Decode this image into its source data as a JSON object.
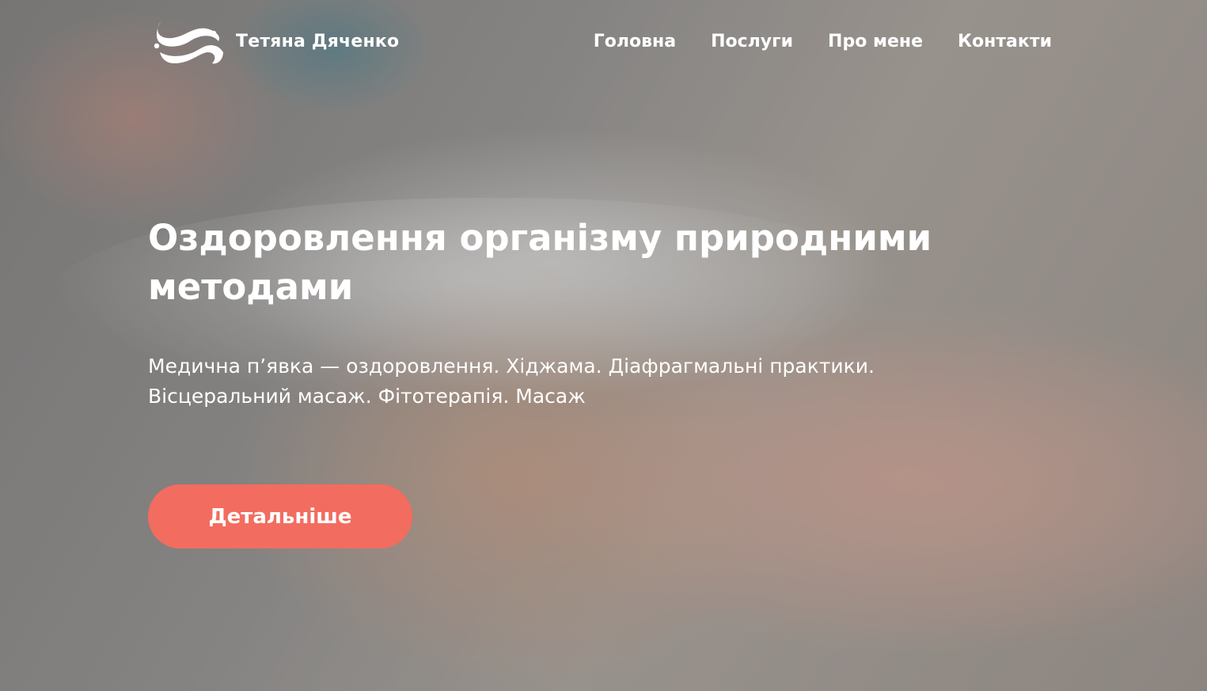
{
  "brand": {
    "name": "Тетяна Дяченко",
    "logo_icon": "wave-figure-icon"
  },
  "nav": {
    "items": [
      {
        "label": "Головна"
      },
      {
        "label": "Послуги"
      },
      {
        "label": "Про мене"
      },
      {
        "label": "Контакти"
      }
    ]
  },
  "hero": {
    "title": "Оздоровлення організму природними методами",
    "subtitle": "Медична п’явка — оздоровлення. Хіджама. Діафрагмальні практики. Вісцеральний масаж. Фітотерапія. Масаж",
    "cta_label": "Детальніше",
    "cta_color": "#f36c60"
  }
}
